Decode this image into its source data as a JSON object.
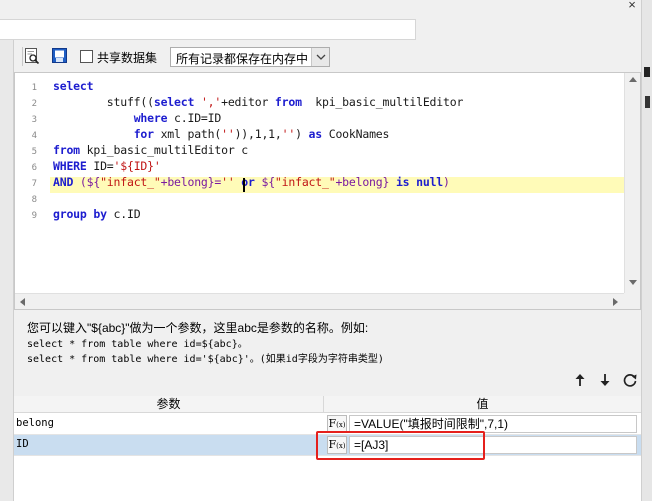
{
  "window": {
    "close_glyph": "×"
  },
  "toolbar": {
    "share_label": "共享数据集",
    "storage_select": "所有记录都保存在内存中"
  },
  "editor": {
    "line_numbers": [
      "1",
      "2",
      "3",
      "4",
      "5",
      "6",
      "7",
      "8",
      "9"
    ],
    "lines": {
      "l1_kw": "select",
      "l2_a": "        stuff((",
      "l2_kw": "select",
      "l2_str": "','",
      "l2_b": "+editor ",
      "l2_kw2": "from",
      "l2_c": "  kpi_basic_multilEditor",
      "l3_a": "            ",
      "l3_kw": "where",
      "l3_b": " c.ID=ID",
      "l4_a": "            ",
      "l4_kw": "for",
      "l4_b": " xml path(",
      "l4_str": "''",
      "l4_c": ")),1,1,",
      "l4_str2": "''",
      "l4_d": ") ",
      "l4_kw2": "as",
      "l4_e": " CookNames",
      "l5_kw": "from",
      "l5_b": " kpi_basic_multilEditor c",
      "l6_kw": "WHERE",
      "l6_b": " ID=",
      "l6_str": "'${ID}'",
      "l7_kw": "AND",
      "l7_b": " (${",
      "l7_str": "\"infact_\"",
      "l7_c": "+belong}=",
      "l7_str2": "''",
      "l7_d": " ",
      "l7_kw2": "or",
      "l7_e": " ${",
      "l7_str3": "\"infact_\"",
      "l7_f": "+belong} ",
      "l7_kw3": "is",
      "l7_g": " ",
      "l7_kw4": "null",
      "l7_h": ")",
      "l9_kw": "group by",
      "l9_b": " c.ID"
    }
  },
  "help": {
    "line1": "您可以键入\"${abc}\"做为一个参数，这里abc是参数的名称。例如:",
    "line2": "select * from table where id=${abc}。",
    "line3": "select * from table where id='${abc}'。(如果id字段为字符串类型)"
  },
  "params": {
    "header_param": "参数",
    "header_value": "值",
    "fx_label": "F",
    "fx_sub": "(x)",
    "rows": [
      {
        "name": "belong",
        "value": "=VALUE(\"填报时间限制\",7,1)"
      },
      {
        "name": "ID",
        "value": "=[AJ3]"
      }
    ]
  },
  "colors": {
    "keyword": "#1d1dcf",
    "string": "#c01515",
    "highlight": "#fffbb8",
    "selected_row": "#c9ddf0",
    "annotation_red": "#e5201c"
  }
}
